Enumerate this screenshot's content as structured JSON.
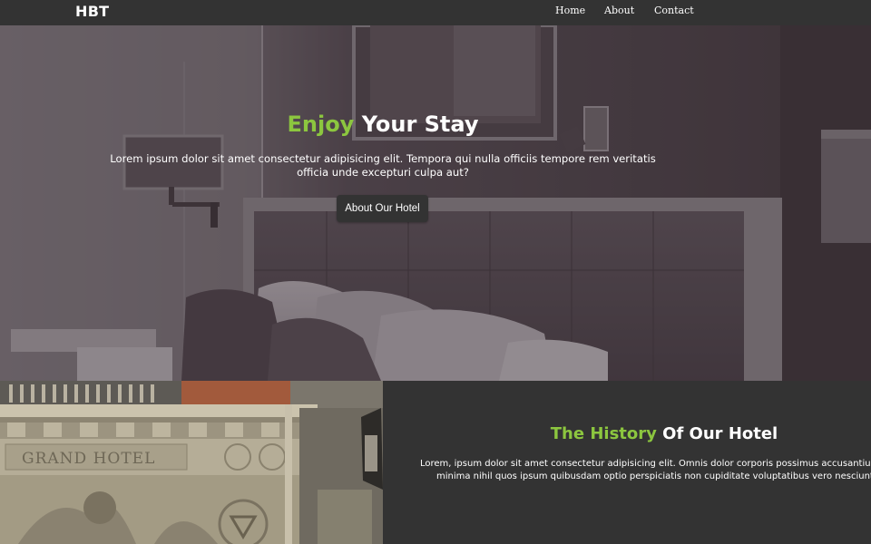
{
  "navbar": {
    "logo": "HBT",
    "links": [
      "Home",
      "About",
      "Contact"
    ]
  },
  "hero": {
    "title_accent": "Enjoy",
    "title_rest": "Your Stay",
    "text": "Lorem ipsum dolor sit amet consectetur adipisicing elit. Tempora qui nulla officiis tempore rem veritatis officia unde excepturi culpa aut?",
    "button_label": "About Our Hotel"
  },
  "history": {
    "title_accent": "The History",
    "title_rest": "Of Our Hotel",
    "text_line1": "Lorem, ipsum dolor sit amet consectetur adipisicing elit. Omnis dolor corporis possimus accusantium impedi",
    "text_line2": "minima nihil quos ipsum quibusdam optio perspiciatis non cupiditate voluptatibus vero nesciunt ullam n",
    "image_sign": "GRAND HOTEL"
  },
  "colors": {
    "accent": "#8cc63f",
    "dark": "#333333",
    "text": "#ffffff"
  }
}
